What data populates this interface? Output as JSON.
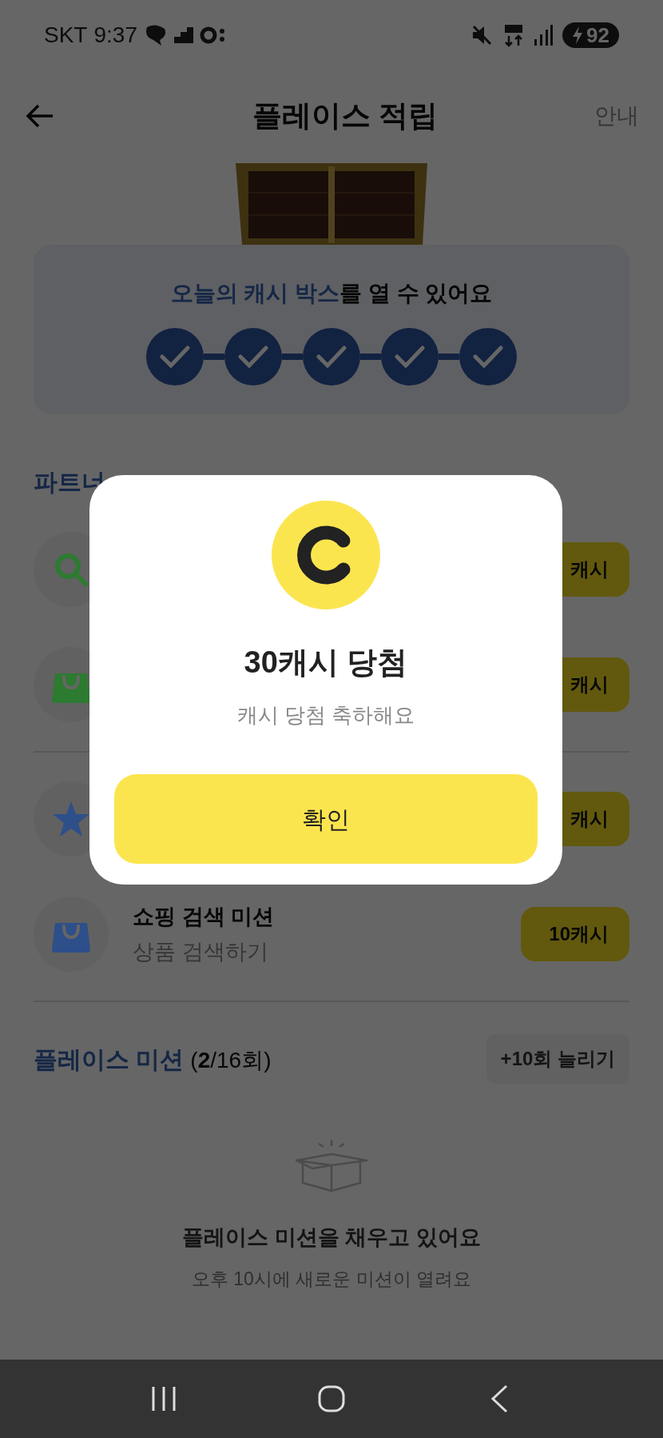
{
  "status_bar": {
    "carrier": "SKT",
    "time": "9:37",
    "battery": "92"
  },
  "header": {
    "title": "플레이스 적립",
    "link": "안내"
  },
  "cash_box": {
    "highlight": "오늘의 캐시 박스",
    "rest": "를 열 수 있어요",
    "steps": [
      {
        "done": true
      },
      {
        "done": true
      },
      {
        "done": true
      },
      {
        "done": true
      },
      {
        "done": true
      }
    ]
  },
  "partner_missions": {
    "heading": "파트너",
    "groups": [
      [
        {
          "kind": "search",
          "color": "#2d7a31",
          "reward": "캐시"
        },
        {
          "kind": "bag",
          "color": "#2d7a31",
          "reward": "캐시"
        }
      ],
      [
        {
          "kind": "star",
          "color": "#2d4f8a",
          "reward": "캐시"
        },
        {
          "kind": "bag",
          "color": "#2d4f8a",
          "title": "쇼핑 검색 미션",
          "subtitle": "상품 검색하기",
          "reward": "10캐시"
        }
      ]
    ]
  },
  "place_missions": {
    "title": "플레이스 미션",
    "count": "(**2**/16회)",
    "button": "+10회 늘리기",
    "empty_title": "플레이스 미션을 채우고 있어요",
    "empty_subtitle": "오후 10시에 새로운 미션이 열려요"
  },
  "dialog": {
    "title": "30캐시 당첨",
    "message": "캐시 당첨 축하해요",
    "button": "확인"
  }
}
